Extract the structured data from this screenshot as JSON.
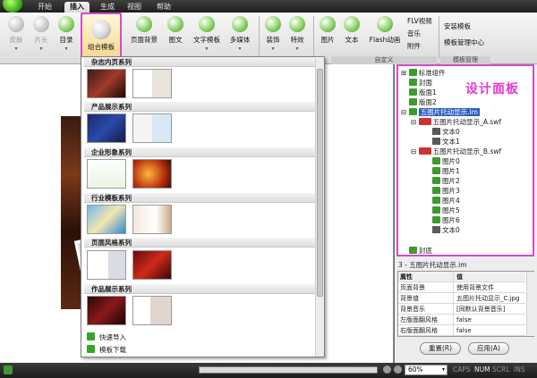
{
  "app": {
    "menu_tabs": [
      "开始",
      "插入",
      "生成",
      "视图",
      "帮助"
    ]
  },
  "ribbon": {
    "buttons": [
      {
        "label": "皮肤",
        "enabled": false
      },
      {
        "label": "片头",
        "enabled": false
      },
      {
        "label": "目录",
        "enabled": true
      },
      {
        "label": "组合模板",
        "enabled": true
      },
      {
        "label": "页面背景",
        "enabled": true
      },
      {
        "label": "图文",
        "enabled": true
      },
      {
        "label": "文字模板",
        "enabled": true
      },
      {
        "label": "多媒体",
        "enabled": true
      },
      {
        "label": "装饰",
        "enabled": true
      },
      {
        "label": "特效",
        "enabled": true
      },
      {
        "label": "图片",
        "enabled": true
      },
      {
        "label": "文本",
        "enabled": true
      },
      {
        "label": "Flash动画",
        "enabled": true
      }
    ],
    "small_items": [
      "FLV视频",
      "音乐",
      "附件"
    ],
    "template_items": [
      "安装模板",
      "模板管理中心"
    ],
    "group_labels": {
      "custom": "自定义",
      "template_mgmt": "模板管理"
    }
  },
  "dropdown": {
    "categories": [
      "杂志内页系列",
      "产品展示系列",
      "企业形象系列",
      "行业模板系列",
      "页面风格系列",
      "作品展示系列"
    ],
    "actions": [
      "快速导入",
      "模板下载"
    ]
  },
  "tree": {
    "overlay_title": "设计面板",
    "nodes": [
      {
        "label": "标准组件",
        "type": "folder",
        "level": 0
      },
      {
        "label": "封面",
        "type": "page",
        "level": 0
      },
      {
        "label": "版面1",
        "type": "page",
        "level": 0
      },
      {
        "label": "版面2",
        "type": "page",
        "level": 0
      },
      {
        "label": "五图片托动显示.im",
        "type": "selected",
        "level": 0
      },
      {
        "label": "五图片托动显示_A.swf",
        "type": "swf",
        "level": 1
      },
      {
        "label": "文本0",
        "type": "text",
        "level": 2
      },
      {
        "label": "文本1",
        "type": "text",
        "level": 2
      },
      {
        "label": "五图片托动显示_B.swf",
        "type": "swf",
        "level": 1
      },
      {
        "label": "图片0",
        "type": "img",
        "level": 2
      },
      {
        "label": "图片1",
        "type": "img",
        "level": 2
      },
      {
        "label": "图片2",
        "type": "img",
        "level": 2
      },
      {
        "label": "图片3",
        "type": "img",
        "level": 2
      },
      {
        "label": "图片4",
        "type": "img",
        "level": 2
      },
      {
        "label": "图片5",
        "type": "img",
        "level": 2
      },
      {
        "label": "图片6",
        "type": "img",
        "level": 2
      },
      {
        "label": "文本0",
        "type": "text",
        "level": 2
      },
      {
        "label": "封底",
        "type": "page",
        "level": 0
      }
    ]
  },
  "selection_path": "3 - 五图片托动显示.im",
  "properties": {
    "header": {
      "key": "属性",
      "value": "值"
    },
    "rows": [
      {
        "key": "页面背景",
        "value": "使用背景文件"
      },
      {
        "key": "背景值",
        "value": "五图片托动显示_C.jpg"
      },
      {
        "key": "背景音乐",
        "value": "[同默认背景音乐]"
      },
      {
        "key": "左版面翻风格",
        "value": "false"
      },
      {
        "key": "右版面翻风格",
        "value": "false"
      }
    ],
    "reset_label": "重置(R)",
    "apply_label": "应用(A)"
  },
  "statusbar": {
    "zoom": "60%",
    "indicators": [
      {
        "label": "CAPS",
        "on": false
      },
      {
        "label": "NUM",
        "on": true
      },
      {
        "label": "SCRL",
        "on": false
      },
      {
        "label": "INS",
        "on": false
      }
    ]
  },
  "colors": {
    "highlight": "#d64ad0",
    "selection": "#2f5fbf",
    "icon_green": "#3e9a2f"
  }
}
